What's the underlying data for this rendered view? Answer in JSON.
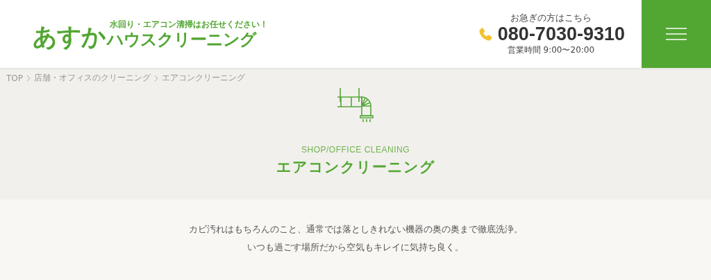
{
  "header": {
    "logo": {
      "main": "あすか",
      "tagline": "水回り・エアコン清掃はお任せください！",
      "sub": "ハウスクリーニング"
    },
    "contact": {
      "note": "お急ぎの方はこちら",
      "phone": "080-7030-9310",
      "hours": "営業時間 9:00〜20:00"
    }
  },
  "breadcrumb": [
    "TOP",
    "店舗・オフィスのクリーニング",
    "エアコンクリーニング"
  ],
  "hero": {
    "subtitle": "SHOP/OFFICE CLEANING",
    "title": "エアコンクリーニング"
  },
  "intro": [
    "カビ汚れはもちろんのこと、通常では落としきれない機器の奥の奥まで徹底洗浄。",
    "いつも過ごす場所だから空気もキレイに気持ち良く。"
  ]
}
